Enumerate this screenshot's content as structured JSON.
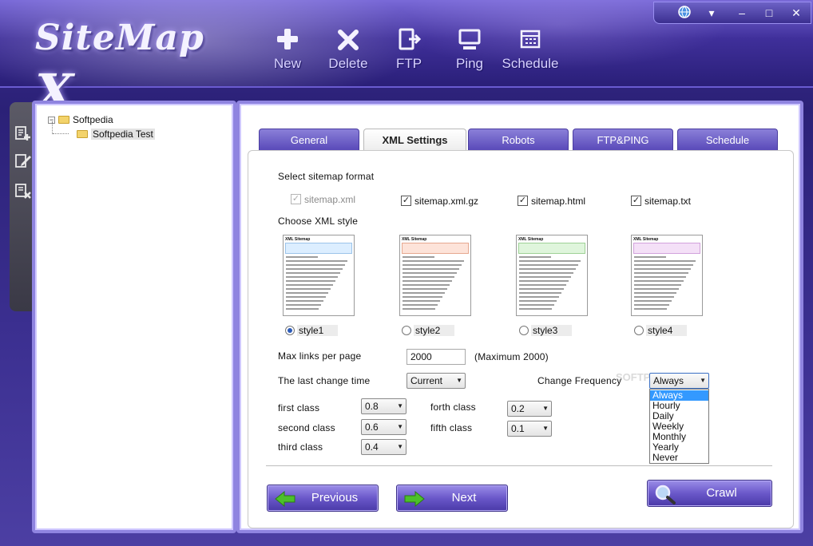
{
  "app": {
    "logo_main": "SiteMap",
    "logo_x": "X"
  },
  "toolbar": {
    "items": [
      {
        "label": "New",
        "icon": "plus-icon"
      },
      {
        "label": "Delete",
        "icon": "x-icon"
      },
      {
        "label": "FTP",
        "icon": "ftp-icon"
      },
      {
        "label": "Ping",
        "icon": "monitor-icon"
      },
      {
        "label": "Schedule",
        "icon": "calendar-icon"
      }
    ]
  },
  "window_controls": {
    "globe": "globe-icon",
    "menu": "▾",
    "minimize": "–",
    "maximize": "□",
    "close": "✕"
  },
  "tree": {
    "root": {
      "label": "Softpedia",
      "expander": "−"
    },
    "child": {
      "label": "Softpedia Test"
    }
  },
  "tabs": [
    {
      "label": "General"
    },
    {
      "label": "XML Settings"
    },
    {
      "label": "Robots"
    },
    {
      "label": "FTP&PING"
    },
    {
      "label": "Schedule"
    }
  ],
  "xml": {
    "select_format_label": "Select sitemap format",
    "formats": [
      {
        "label": "sitemap.xml",
        "checked": true,
        "disabled": true
      },
      {
        "label": "sitemap.xml.gz",
        "checked": true
      },
      {
        "label": "sitemap.html",
        "checked": true
      },
      {
        "label": "sitemap.txt",
        "checked": true
      }
    ],
    "choose_style_label": "Choose XML style",
    "preview_title": "XML Sitemap",
    "styles": [
      {
        "label": "style1",
        "selected": true,
        "band_color": "#dceeff",
        "band_border": "#9cc4ea"
      },
      {
        "label": "style2",
        "selected": false,
        "band_color": "#fde3d9",
        "band_border": "#e6a890"
      },
      {
        "label": "style3",
        "selected": false,
        "band_color": "#dff5dc",
        "band_border": "#9ed196"
      },
      {
        "label": "style4",
        "selected": false,
        "band_color": "#f4e0f7",
        "band_border": "#d2a2dc"
      }
    ],
    "max_links_label": "Max links per page",
    "max_links_value": "2000",
    "max_links_note": "(Maximum 2000)",
    "last_change_label": "The last change time",
    "last_change_value": "Current",
    "change_freq_label": "Change Frequency",
    "change_freq_value": "Always",
    "freq_options": [
      "Always",
      "Hourly",
      "Daily",
      "Weekly",
      "Monthly",
      "Yearly",
      "Never"
    ],
    "priorities": [
      {
        "label": "first class",
        "value": "0.8"
      },
      {
        "label": "second class",
        "value": "0.6"
      },
      {
        "label": "third class",
        "value": "0.4"
      },
      {
        "label": "forth class",
        "value": "0.2"
      },
      {
        "label": "fifth class",
        "value": "0.1"
      }
    ]
  },
  "buttons": {
    "previous": "Previous",
    "next": "Next",
    "crawl": "Crawl"
  },
  "watermark": "SOFTPEDIA"
}
